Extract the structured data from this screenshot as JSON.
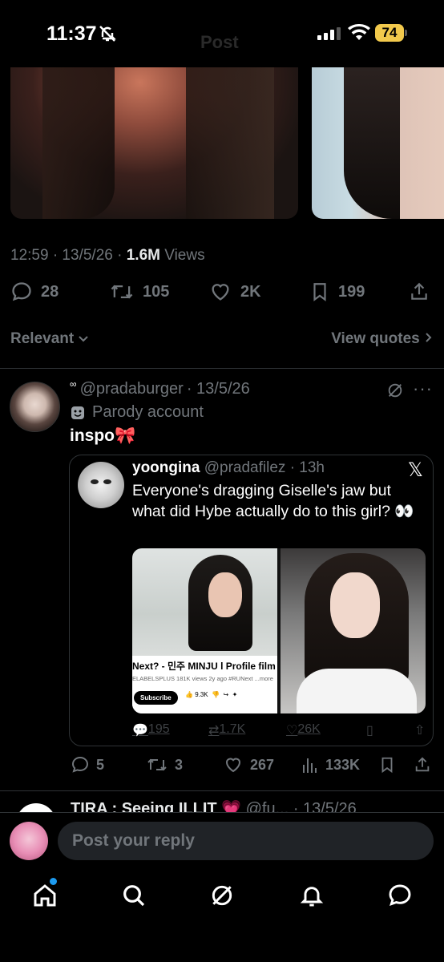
{
  "status_bar": {
    "time": "11:37",
    "battery": "74",
    "faded_title": "Post"
  },
  "post": {
    "timestamp": "12:59 · 13/5/26 · ",
    "views_count": "1.6M",
    "views_label": " Views",
    "replies": "28",
    "reposts": "105",
    "likes": "2K",
    "bookmarks": "199"
  },
  "sort": {
    "label": "Relevant",
    "quotes_link": "View quotes"
  },
  "reply": {
    "handle": "@pradaburger",
    "date": "· 13/5/26",
    "parody_label": "Parody account",
    "text": "inspo🎀",
    "quote": {
      "name": "yoongina",
      "handle": "@pradafilez",
      "time": "· 13h",
      "text": "Everyone's dragging Giselle's jaw but what did Hybe actually do to this girl? 👀",
      "media_caption": "Next? - 민주 MINJU l Profile film",
      "media_meta": "ELABELSPLUS  181K views  2y ago  #RUNext  ...more",
      "media_subscribe": "Subscribe",
      "media_likes": "9.3K",
      "stats": {
        "replies": "195",
        "reposts": "1.7K",
        "likes": "26K"
      }
    },
    "replies": "5",
    "reposts": "3",
    "likes": "267",
    "views": "133K"
  },
  "next_tweet_peek": {
    "name": "TIRA : Seeing ILLIT 💗",
    "handle": "@fu...",
    "date": "· 13/5/26"
  },
  "composer": {
    "placeholder": "Post your reply"
  },
  "tabs": [
    "home",
    "search",
    "grok",
    "notifications",
    "messages"
  ],
  "colors": {
    "background": "#000000",
    "secondary_text": "#71767b",
    "divider": "#2f3336",
    "accent": "#1d9bf0",
    "battery": "#f2c94c"
  }
}
